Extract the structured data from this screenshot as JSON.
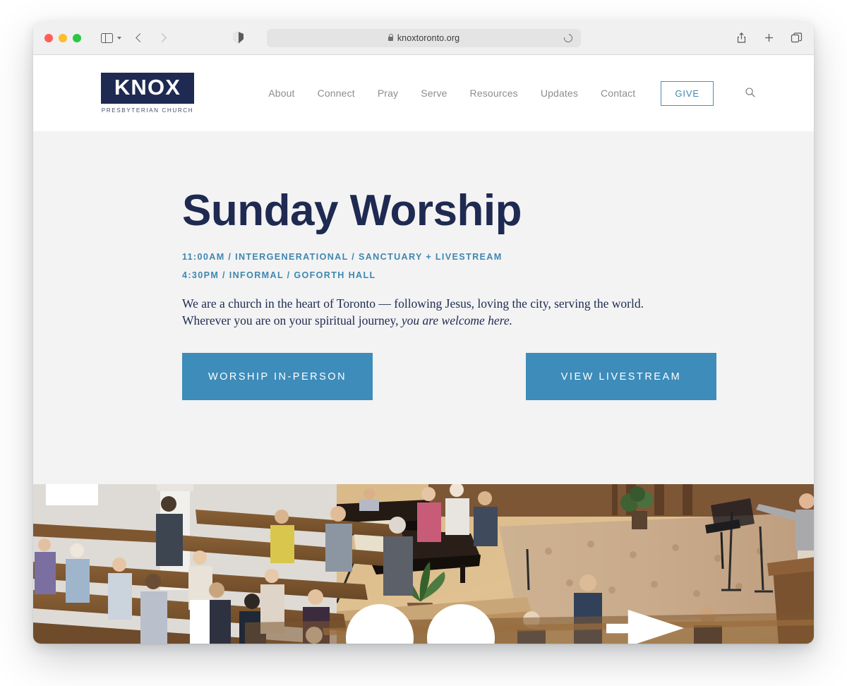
{
  "browser": {
    "url": "knoxtoronto.org",
    "icons": {
      "sidebar": "sidebar-icon",
      "chevron": "chevron-down-icon",
      "back": "back-arrow-icon",
      "forward": "forward-arrow-icon",
      "shield": "privacy-shield-icon",
      "lock": "lock-icon",
      "reload": "reload-icon",
      "share": "share-icon",
      "new_tab": "plus-icon",
      "tabs": "tab-overview-icon"
    }
  },
  "site": {
    "logo": {
      "word": "KNOX",
      "subtitle": "PRESBYTERIAN CHURCH"
    },
    "nav": [
      {
        "label": "About"
      },
      {
        "label": "Connect"
      },
      {
        "label": "Pray"
      },
      {
        "label": "Serve"
      },
      {
        "label": "Resources"
      },
      {
        "label": "Updates"
      },
      {
        "label": "Contact"
      }
    ],
    "give_label": "GIVE",
    "search_icon": "search-icon"
  },
  "hero": {
    "title": "Sunday Worship",
    "service_lines": [
      "11:00AM / INTERGENERATIONAL / SANCTUARY + LIVESTREAM",
      "4:30PM / INFORMAL  / GOFORTH HALL"
    ],
    "body_line1": "We are a church in the heart of Toronto — following Jesus, loving the city, serving the world.",
    "body_line2_start": "Wherever you are on your spiritual journey, ",
    "body_line2_italic": "you are welcome here.",
    "cta_primary": "WORSHIP IN-PERSON",
    "cta_secondary": "VIEW LIVESTREAM"
  },
  "colors": {
    "navy": "#1f2a52",
    "blue": "#3d8cba",
    "hero_bg": "#f3f3f3",
    "nav_gray": "#8d8d8d"
  }
}
